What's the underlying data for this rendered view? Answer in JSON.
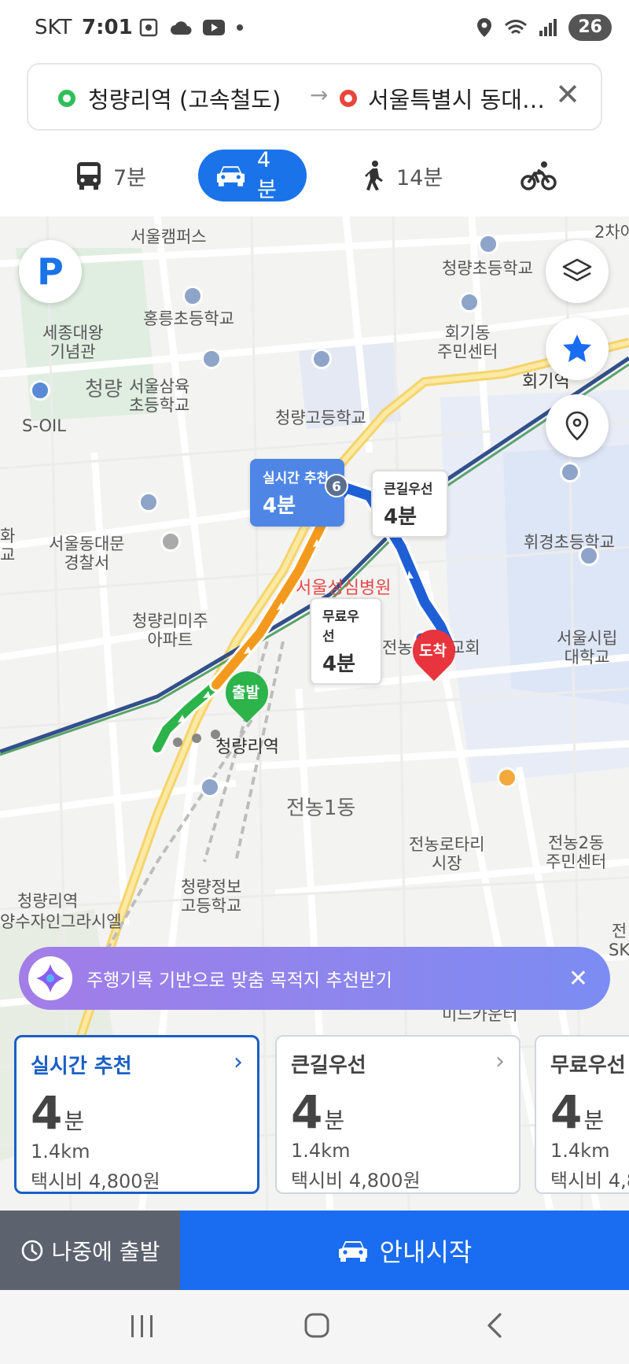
{
  "status_bar": {
    "carrier": "SKT",
    "time": "7:01",
    "battery": "26"
  },
  "route_search": {
    "origin": "청량리역 (고속철도)",
    "arrow": "→",
    "destination": "서울특별시 동대문…",
    "close": "✕"
  },
  "mode_tabs": {
    "bus": "7분",
    "car": "4분",
    "walk": "14분",
    "active": "car"
  },
  "map": {
    "labels": {
      "seoul_campus": "서울캠퍼스",
      "cheongnyang_elem": "청량초등학교",
      "hongneung_elem": "홍릉초등학교",
      "sejong": "세종대왕\n기념관",
      "hoegi_center": "회기동\n주민센터",
      "hoegi_station": "회기역",
      "cheongnyang": "청량",
      "seoul_samyuk": "서울삼육\n초등학교",
      "cheongnyang_high": "청량고등학교",
      "soil": "S-OIL",
      "dongdaemun_police": "서울동대문\n경찰서",
      "seongsim_hospital": "서울성심병원",
      "hwigyeong_elem": "휘경초등학교",
      "misu_apt": "청량리미주\n아파트",
      "seoul_city_univ": "서울시립\n대학교",
      "jeonnong_church": "전농",
      "church_suffix": "교회",
      "cheongnyangni_station": "청량리역",
      "jeonnong1": "전농1동",
      "rotary_market": "전농로타리\n시장",
      "jeonnong2_center": "전농2동\n주민센터",
      "cheongnyang_info_high": "청량정보\n고등학교",
      "cheongnyang_station_sm": "청량리역",
      "grasiel": "양수자인그라시엘",
      "mid_counter": "미드카운터",
      "edge_right_1": "2차아",
      "edge_left_1": "화\n교",
      "edge_right_2": "전\nSK"
    },
    "parking_button": "P",
    "callouts": {
      "realtime": {
        "title": "실시간 추천",
        "time": "4분"
      },
      "highway": {
        "title": "큰길우선",
        "time": "4분"
      },
      "free": {
        "title": "무료우선",
        "time": "4분"
      }
    },
    "route_number": "6",
    "start_marker": "출발",
    "end_marker": "도착"
  },
  "banner": {
    "text": "주행기록 기반으로 맞춤 목적지 추천받기",
    "close": "✕"
  },
  "route_cards": [
    {
      "title": "실시간 추천",
      "time": "4",
      "unit": "분",
      "distance": "1.4km",
      "fare": "택시비 4,800원",
      "chevron": "›"
    },
    {
      "title": "큰길우선",
      "time": "4",
      "unit": "분",
      "distance": "1.4km",
      "fare": "택시비 4,800원",
      "chevron": "›"
    },
    {
      "title": "무료우선",
      "time": "4",
      "unit": "분",
      "distance": "1.4km",
      "fare": "택시비 4,8",
      "chevron": ""
    }
  ],
  "bottom_bar": {
    "later": "나중에 출발",
    "start": "안내시작"
  },
  "colors": {
    "primary_blue": "#1a73e8",
    "route_green": "#2cb34a",
    "route_orange": "#f39a1e",
    "route_blue": "#1f5fd6",
    "dest_red": "#e8343c"
  }
}
